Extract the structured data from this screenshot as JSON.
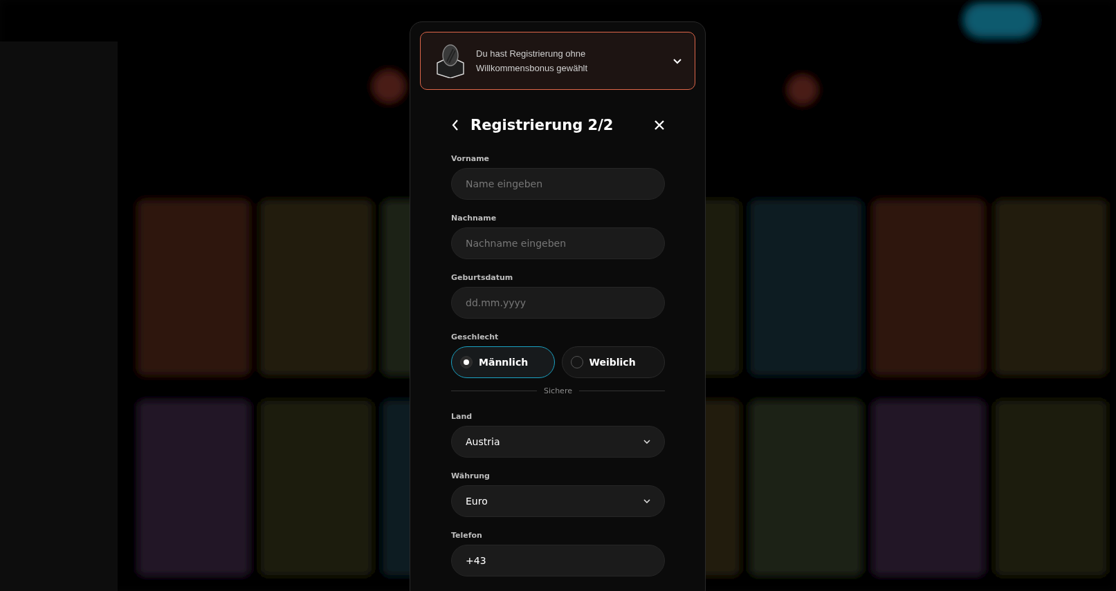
{
  "bonus_banner": {
    "text": "Du hast Registrierung ohne Willkommensbonus gewählt",
    "expanded": false
  },
  "dialog": {
    "title": "Registrierung 2/2"
  },
  "form": [
    {
      "kind": "text",
      "label": "Vorname",
      "placeholder": "Name eingeben"
    },
    {
      "kind": "text",
      "label": "Nachname",
      "placeholder": "Nachname eingeben"
    },
    {
      "kind": "text",
      "label": "Geburtsdatum",
      "placeholder": "dd.mm.yyyy"
    },
    {
      "kind": "radio",
      "label": "Geschlecht",
      "options": [
        {
          "label": "Männlich",
          "selected": true
        },
        {
          "label": "Weiblich",
          "selected": false
        }
      ]
    },
    {
      "kind": "divider",
      "label": "Sichere"
    },
    {
      "kind": "select",
      "label": "Land",
      "value": "Austria"
    },
    {
      "kind": "select",
      "label": "Währung",
      "value": "Euro"
    },
    {
      "kind": "value",
      "label": "Telefon",
      "value": "+43"
    }
  ]
}
